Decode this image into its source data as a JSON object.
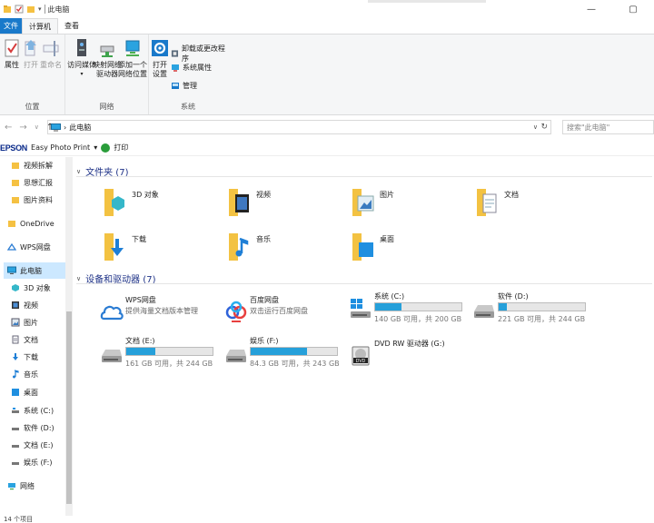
{
  "window": {
    "title": "此电脑",
    "controls": {
      "minimize": "—",
      "maximize": "▢"
    }
  },
  "tabs": [
    {
      "label": "文件"
    },
    {
      "label": "计算机"
    },
    {
      "label": "查看"
    }
  ],
  "ribbon": {
    "groups": [
      {
        "label": "位置",
        "buttons": [
          "属性",
          "打开",
          "重命名"
        ]
      },
      {
        "label": "网络",
        "buttons": [
          "访问媒体",
          "映射网络\n驱动器",
          "添加一个\n网络位置"
        ]
      },
      {
        "label": "系统",
        "buttons": [
          "打开\n设置"
        ],
        "small": [
          "卸载或更改程序",
          "系统属性",
          "管理"
        ]
      }
    ]
  },
  "address": {
    "path_sep": "›",
    "path": "此电脑",
    "refresh": "↻",
    "dropdown": "∨",
    "search_placeholder": "搜索\"此电脑\""
  },
  "epson": {
    "brand": "EPSON",
    "app": "Easy Photo Print",
    "dropdown": "▾",
    "print": "打印"
  },
  "sidebar": {
    "items": [
      {
        "label": "视频拆解",
        "icon": "folder-icon"
      },
      {
        "label": "思想汇报",
        "icon": "folder-icon"
      },
      {
        "label": "图片资料",
        "icon": "folder-icon"
      },
      {
        "label": "OneDrive",
        "icon": "onedrive-icon"
      },
      {
        "label": "WPS网盘",
        "icon": "wps-cloud-icon"
      },
      {
        "label": "此电脑",
        "icon": "pc-icon"
      },
      {
        "label": "3D 对象",
        "icon": "3d-objects-icon"
      },
      {
        "label": "视频",
        "icon": "video-icon"
      },
      {
        "label": "图片",
        "icon": "picture-icon"
      },
      {
        "label": "文档",
        "icon": "document-icon"
      },
      {
        "label": "下载",
        "icon": "download-icon"
      },
      {
        "label": "音乐",
        "icon": "music-icon"
      },
      {
        "label": "桌面",
        "icon": "desktop-icon"
      },
      {
        "label": "系统 (C:)",
        "icon": "drive-c-icon"
      },
      {
        "label": "软件 (D:)",
        "icon": "drive-icon"
      },
      {
        "label": "文档 (E:)",
        "icon": "drive-icon"
      },
      {
        "label": "娱乐 (F:)",
        "icon": "drive-icon"
      },
      {
        "label": "网络",
        "icon": "network-icon"
      }
    ]
  },
  "folders_section": {
    "title": "文件夹 (7)",
    "items": [
      {
        "label": "3D 对象",
        "icon": "3d-objects-folder-icon"
      },
      {
        "label": "视频",
        "icon": "video-folder-icon"
      },
      {
        "label": "图片",
        "icon": "picture-folder-icon"
      },
      {
        "label": "文档",
        "icon": "document-folder-icon"
      },
      {
        "label": "下载",
        "icon": "download-folder-icon"
      },
      {
        "label": "音乐",
        "icon": "music-folder-icon"
      },
      {
        "label": "桌面",
        "icon": "desktop-folder-icon"
      }
    ]
  },
  "devices_section": {
    "title": "设备和驱动器 (7)",
    "items": [
      {
        "name": "WPS网盘",
        "sub": "提供海量文档版本管理",
        "icon": "wps-cloud-icon"
      },
      {
        "name": "百度网盘",
        "sub": "双击运行百度网盘",
        "icon": "baidu-netdisk-icon"
      },
      {
        "name": "系统 (C:)",
        "space": "140 GB 可用，共 200 GB",
        "used_fraction": 0.3,
        "icon": "windows-drive-icon"
      },
      {
        "name": "软件 (D:)",
        "space": "221 GB 可用，共 244 GB",
        "used_fraction": 0.09,
        "icon": "drive-icon"
      },
      {
        "name": "文档 (E:)",
        "space": "161 GB 可用，共 244 GB",
        "used_fraction": 0.34,
        "icon": "drive-icon"
      },
      {
        "name": "娱乐 (F:)",
        "space": "84.3 GB 可用，共 243 GB",
        "used_fraction": 0.65,
        "icon": "drive-icon"
      },
      {
        "name": "DVD RW 驱动器 (G:)",
        "icon": "dvd-drive-icon"
      }
    ]
  },
  "status": {
    "text": "14 个项目"
  },
  "colors": {
    "accent": "#1979ca",
    "bar_fill": "#26a0da",
    "section_title": "#1e3287",
    "selected": "#cce8ff"
  }
}
